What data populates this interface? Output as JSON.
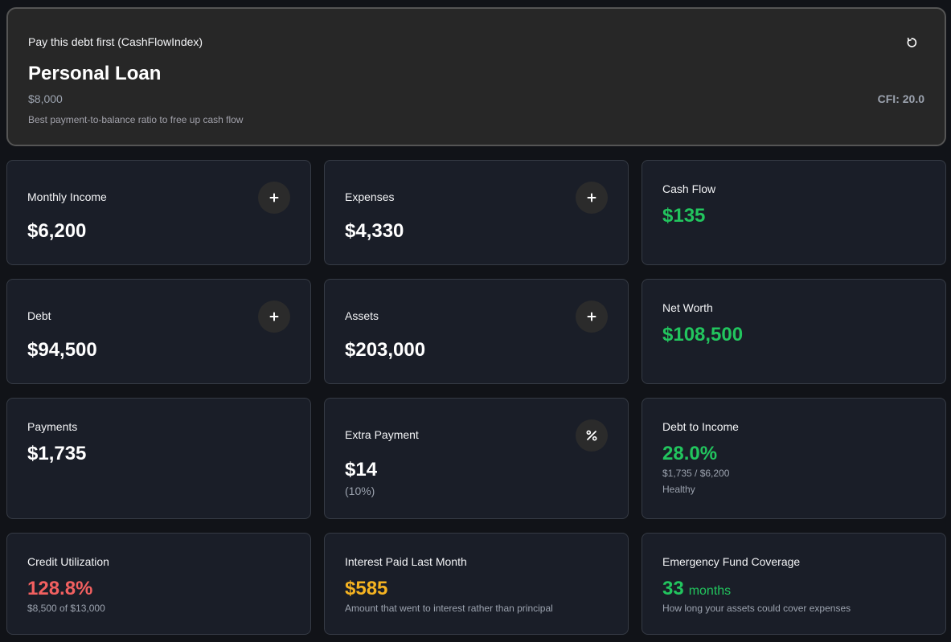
{
  "banner": {
    "heading": "Pay this debt first (CashFlowIndex)",
    "title": "Personal Loan",
    "amount": "$8,000",
    "description": "Best payment-to-balance ratio to free up cash flow",
    "cfi": "CFI: 20.0",
    "refresh_icon": "refresh-icon"
  },
  "cards": {
    "monthly_income": {
      "label": "Monthly Income",
      "value": "$6,200",
      "action_icon": "plus-icon"
    },
    "expenses": {
      "label": "Expenses",
      "value": "$4,330",
      "action_icon": "plus-icon"
    },
    "cash_flow": {
      "label": "Cash Flow",
      "value": "$135"
    },
    "debt": {
      "label": "Debt",
      "value": "$94,500",
      "action_icon": "plus-icon"
    },
    "assets": {
      "label": "Assets",
      "value": "$203,000",
      "action_icon": "plus-icon"
    },
    "net_worth": {
      "label": "Net Worth",
      "value": "$108,500"
    },
    "payments": {
      "label": "Payments",
      "value": "$1,735"
    },
    "extra_payment": {
      "label": "Extra Payment",
      "value": "$14",
      "sub": "(10%)",
      "action_icon": "percent-icon"
    },
    "debt_to_income": {
      "label": "Debt to Income",
      "value": "28.0%",
      "detail": "$1,735 / $6,200",
      "status": "Healthy"
    },
    "credit_utilization": {
      "label": "Credit Utilization",
      "value": "128.8%",
      "detail": "$8,500 of $13,000"
    },
    "interest_paid": {
      "label": "Interest Paid Last Month",
      "value": "$585",
      "detail": "Amount that went to interest rather than principal"
    },
    "emergency_fund": {
      "label": "Emergency Fund Coverage",
      "value": "33",
      "unit": "months",
      "detail": "How long your assets could cover expenses"
    }
  },
  "colors": {
    "positive": "#22c55e",
    "negative": "#f26060",
    "warning": "#f5b321",
    "card_bg": "#1a1e28",
    "page_bg": "#111318"
  }
}
